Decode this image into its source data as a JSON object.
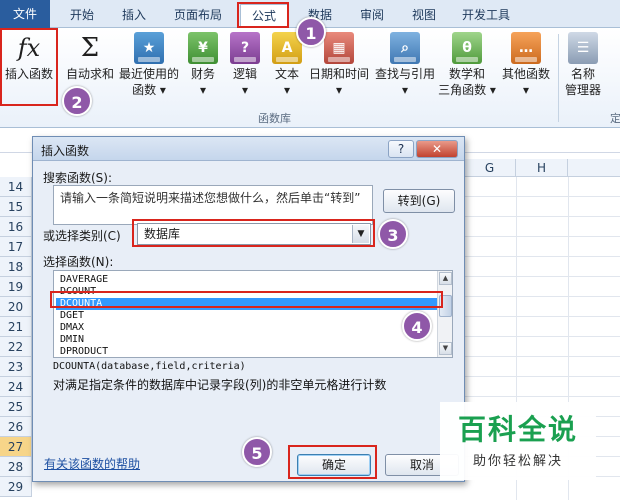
{
  "ribbon": {
    "tabs": [
      "文件",
      "开始",
      "插入",
      "页面布局",
      "公式",
      "数据",
      "审阅",
      "视图",
      "开发工具"
    ],
    "active_tab": "公式",
    "buttons": {
      "insert_function": {
        "label": "插入函数",
        "icon": "fx-icon"
      },
      "autosum": {
        "label": "自动求和",
        "icon": "sigma-icon"
      },
      "recent": {
        "label": "最近使用的",
        "sub": "函数 ▾"
      },
      "financial": {
        "label": "财务",
        "sub": "▾"
      },
      "logical": {
        "label": "逻辑",
        "sub": "▾"
      },
      "text": {
        "label": "文本",
        "sub": "▾"
      },
      "datetime": {
        "label": "日期和时间",
        "sub": "▾"
      },
      "lookup": {
        "label": "查找与引用",
        "sub": "▾"
      },
      "math": {
        "label": "数学和",
        "sub": "三角函数 ▾"
      },
      "other": {
        "label": "其他函数",
        "sub": "▾"
      },
      "name_manager": {
        "label": "名称",
        "sub": "管理器"
      }
    },
    "group_label": "函数库",
    "edge_label": "定"
  },
  "sheet": {
    "columns": [
      "G",
      "H"
    ],
    "rows": [
      "14",
      "15",
      "16",
      "17",
      "18",
      "19",
      "20",
      "21",
      "22",
      "23",
      "24",
      "25",
      "26",
      "27",
      "28",
      "29"
    ],
    "selected_row": "27"
  },
  "dialog": {
    "title": "插入函数",
    "help_btn": "?",
    "close_btn": "✕",
    "search_label": "搜索函数(S):",
    "search_text": "请输入一条简短说明来描述您想做什么，然后单击“转到”",
    "goto_label": "转到(G)",
    "category_label": "或选择类别(C)",
    "category_value": "数据库",
    "select_label": "选择函数(N):",
    "functions": [
      "DAVERAGE",
      "DCOUNT",
      "DCOUNTA",
      "DGET",
      "DMAX",
      "DMIN",
      "DPRODUCT"
    ],
    "selected_function": "DCOUNTA",
    "signature": "DCOUNTA(database,field,criteria)",
    "description": "对满足指定条件的数据库中记录字段(列)的非空单元格进行计数",
    "help_link": "有关该函数的帮助",
    "ok_label": "确定",
    "cancel_label": "取消"
  },
  "annotations": [
    "1",
    "2",
    "3",
    "4",
    "5"
  ],
  "watermark": {
    "title": "百科全说",
    "subtitle": "助你轻松解决"
  },
  "colors": {
    "highlight": "#d9251d",
    "badge": "#8f58a8",
    "selection": "#3399ff",
    "watermark": "#1aa050"
  }
}
